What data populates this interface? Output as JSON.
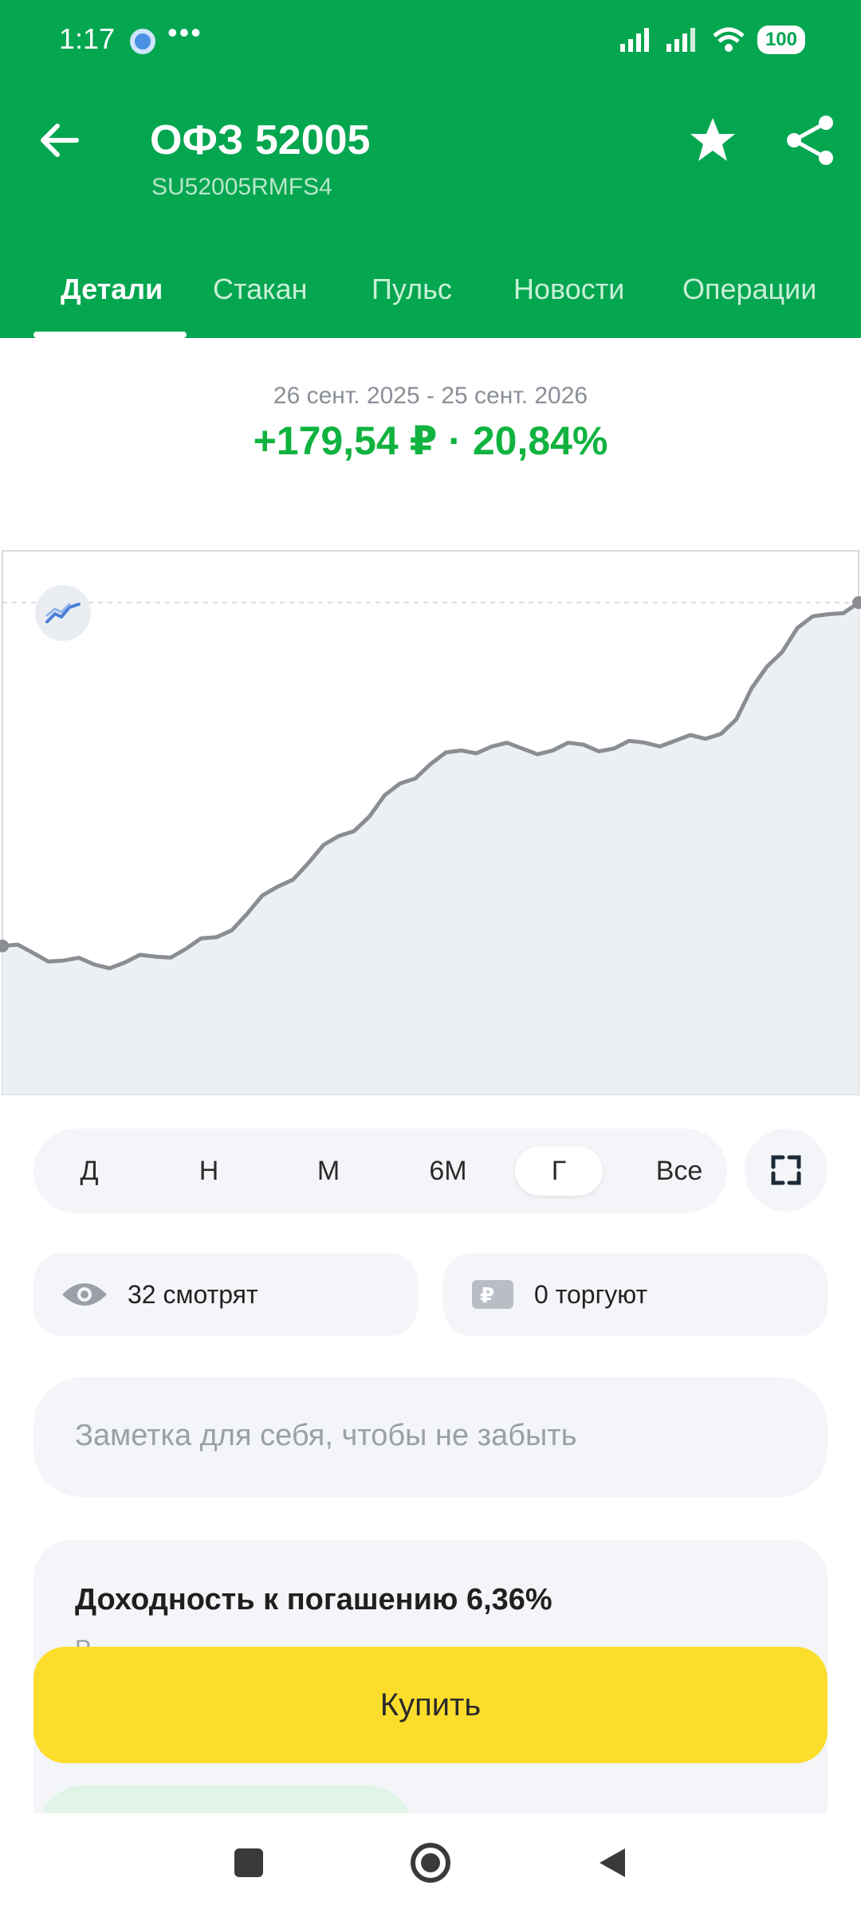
{
  "status": {
    "time": "1:17",
    "more": "•••",
    "battery": "100"
  },
  "header": {
    "title": "ОФЗ 52005",
    "isin": "SU52005RMFS4"
  },
  "tabs": [
    {
      "label": "Детали",
      "active": true
    },
    {
      "label": "Стакан",
      "active": false
    },
    {
      "label": "Пульс",
      "active": false
    },
    {
      "label": "Новости",
      "active": false
    },
    {
      "label": "Операции",
      "active": false
    }
  ],
  "summary": {
    "period": "26 сент. 2025 - 25 сент. 2026",
    "change": "+179,54 ₽ · 20,84%",
    "change_color": "#10B33F"
  },
  "chart_data": {
    "type": "area",
    "x_start": "26 сент. 2025",
    "x_end": "25 сент. 2026",
    "y": [
      861.5,
      858,
      854,
      852,
      853,
      856,
      860,
      866,
      878,
      892,
      904,
      918,
      928,
      945,
      955,
      962,
      964,
      963,
      962,
      965,
      963,
      966,
      967,
      968,
      978,
      1005,
      1025,
      1032,
      1038
    ]
  },
  "range": {
    "items": [
      {
        "label": "Д",
        "active": false
      },
      {
        "label": "Н",
        "active": false
      },
      {
        "label": "М",
        "active": false
      },
      {
        "label": "6М",
        "active": false
      },
      {
        "label": "Г",
        "active": true
      },
      {
        "label": "Все",
        "active": false
      }
    ]
  },
  "stats": {
    "watching": "32 смотрят",
    "trading": "0 торгуют"
  },
  "note": {
    "placeholder": "Заметка для себя, чтобы не забыть"
  },
  "yield": {
    "title": "Доходность к погашению 6,36%",
    "subtitle": "Р"
  },
  "actions": {
    "buy": "Купить"
  },
  "colors": {
    "brand": "#04A650",
    "buy": "#FDDD2B",
    "chart_line": "#8a8d92",
    "chart_fill": "#eceff3"
  }
}
